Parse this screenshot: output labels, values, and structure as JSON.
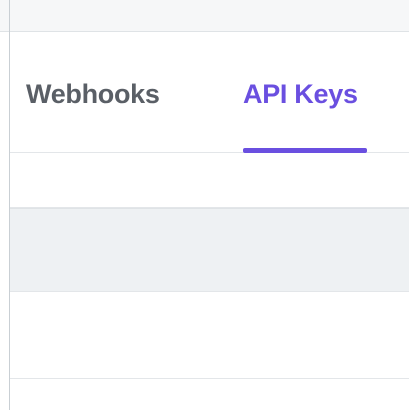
{
  "tabs": [
    {
      "label": "Webhooks",
      "active": false
    },
    {
      "label": "API Keys",
      "active": true
    }
  ],
  "colors": {
    "accent": "#6a4fe0",
    "inactive_tab_text": "#5a5f66",
    "highlight_row": "#eef1f3"
  }
}
